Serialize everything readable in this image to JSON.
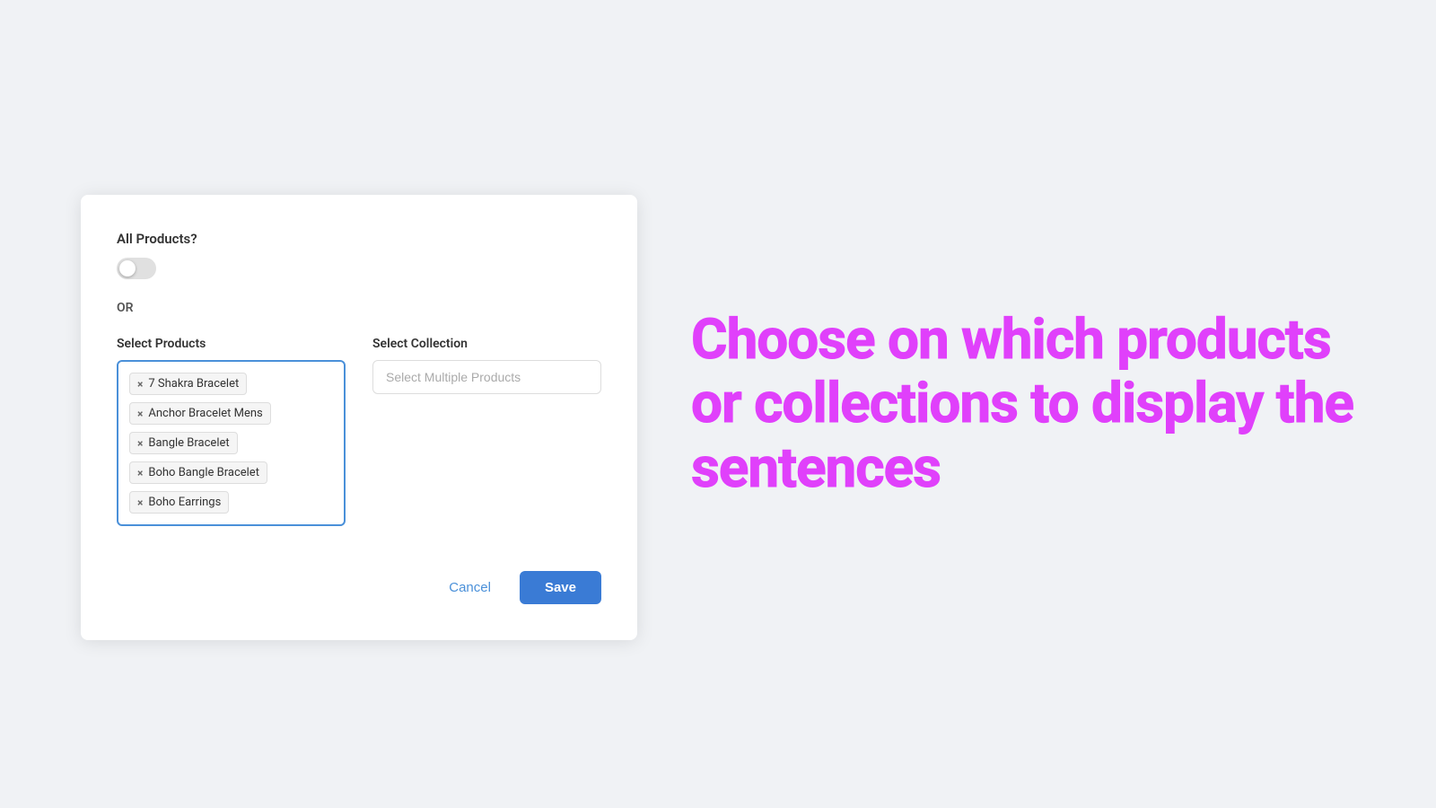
{
  "panel": {
    "all_products_label": "All Products?",
    "or_label": "OR",
    "select_products_label": "Select Products",
    "select_collection_label": "Select Collection",
    "collection_placeholder": "Select Multiple Products",
    "products": [
      {
        "id": "7-shakra",
        "label": "7 Shakra Bracelet"
      },
      {
        "id": "anchor-bracelet",
        "label": "Anchor Bracelet Mens"
      },
      {
        "id": "bangle-bracelet",
        "label": "Bangle Bracelet"
      },
      {
        "id": "boho-bangle",
        "label": "Boho Bangle Bracelet"
      },
      {
        "id": "boho-earrings",
        "label": "Boho Earrings"
      }
    ],
    "cancel_label": "Cancel",
    "save_label": "Save"
  },
  "promo": {
    "text": "Choose on which products or collections to display the sentences"
  }
}
